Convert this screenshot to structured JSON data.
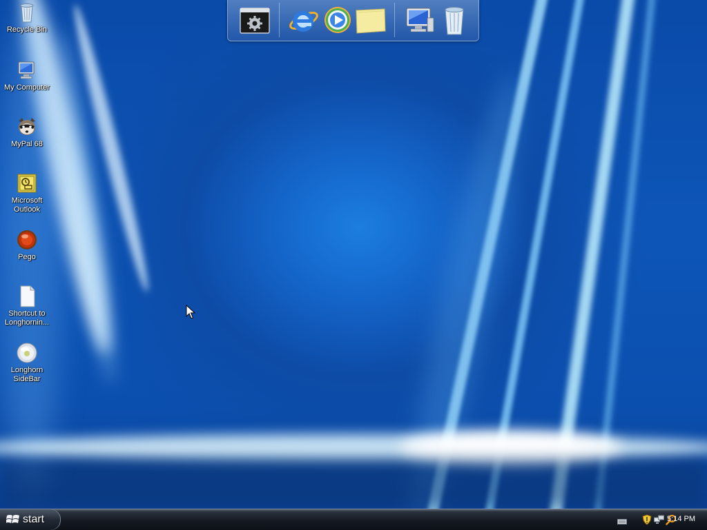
{
  "desktop_icons": [
    {
      "label": "Recycle Bin",
      "icon": "recycle-bin-icon"
    },
    {
      "label": "My Computer",
      "icon": "my-computer-icon"
    },
    {
      "label": "MyPal 68",
      "icon": "mypal-raccoon-icon"
    },
    {
      "label_line1": "Microsoft",
      "label_line2": "Outlook",
      "icon": "outlook-icon"
    },
    {
      "label": "Pego",
      "icon": "pego-icon"
    },
    {
      "label_line1": "Shortcut to",
      "label_line2": "Longhornin...",
      "icon": "document-shortcut-icon"
    },
    {
      "label_line1": "Longhorn",
      "label_line2": "SideBar",
      "icon": "sidebar-orb-icon"
    }
  ],
  "dock": {
    "items": [
      "console-settings-icon",
      "internet-explorer-icon",
      "media-player-icon",
      "sticky-note-icon",
      "my-computer-icon",
      "recycle-bin-icon"
    ]
  },
  "taskbar": {
    "start_label": "start",
    "clock": "5:14 PM",
    "tray_icons": [
      "keyboard-icon",
      "security-shield-icon",
      "network-icon",
      "search-icon"
    ]
  },
  "colors": {
    "accent": "#1464c8",
    "taskbar": "#151a22"
  }
}
